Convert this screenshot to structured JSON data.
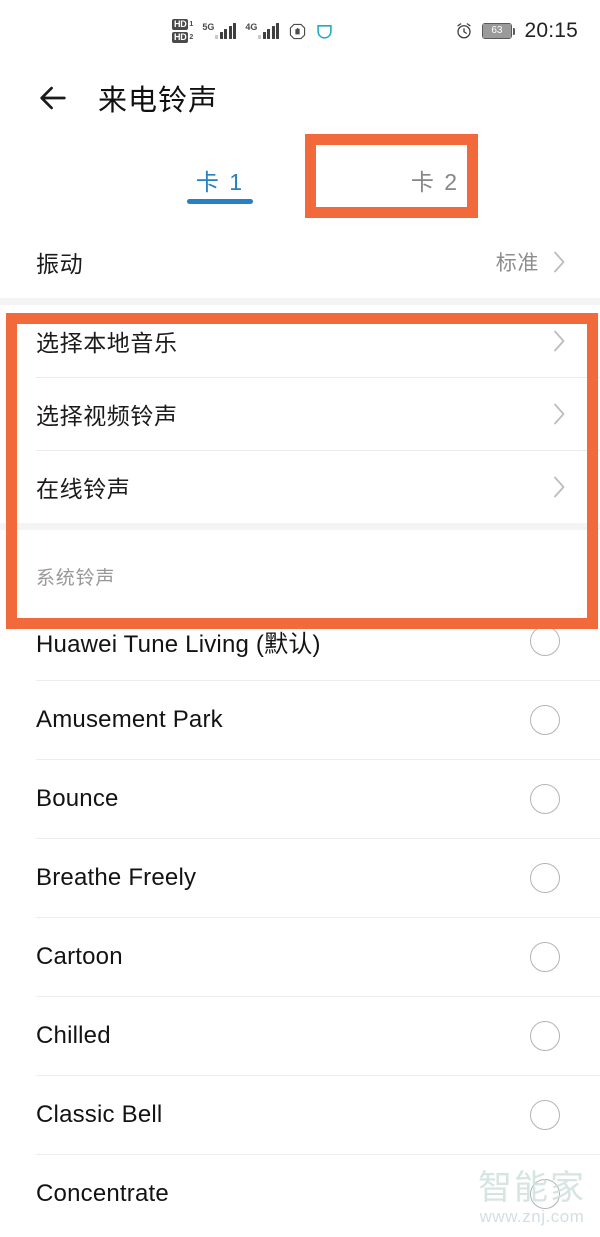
{
  "colors": {
    "annotation": "#f2693c",
    "accent_blue": "#2580c4",
    "divider": "#ebebeb",
    "band": "#f4f4f4",
    "muted_text": "#8d8d8d"
  },
  "status_bar": {
    "hd_primary": "HD",
    "hd_primary_sub": "1",
    "hd_secondary": "HD",
    "hd_secondary_sub": "2",
    "network_primary": "5G",
    "network_secondary": "4G",
    "hand_icon": "hand-stop-icon",
    "shield_icon": "shield-icon",
    "alarm_icon": "alarm-clock-icon",
    "battery_level": "63",
    "time": "20:15"
  },
  "appbar": {
    "back_icon": "back-arrow-icon",
    "title": "来电铃声"
  },
  "tabs": {
    "items": [
      {
        "label": "卡 1",
        "active": true
      },
      {
        "label": "卡 2",
        "active": false
      }
    ]
  },
  "vibration": {
    "title": "振动",
    "value": "标准",
    "chevron_icon": "chevron-right-icon"
  },
  "source_options": [
    {
      "title": "选择本地音乐",
      "chevron_icon": "chevron-right-icon"
    },
    {
      "title": "选择视频铃声",
      "chevron_icon": "chevron-right-icon"
    },
    {
      "title": "在线铃声",
      "chevron_icon": "chevron-right-icon"
    }
  ],
  "system_section": {
    "header": "系统铃声"
  },
  "ringtones": [
    {
      "name": "Huawei Tune Living (默认)",
      "selected": false
    },
    {
      "name": "Amusement Park",
      "selected": false
    },
    {
      "name": "Bounce",
      "selected": false
    },
    {
      "name": "Breathe Freely",
      "selected": false
    },
    {
      "name": "Cartoon",
      "selected": false
    },
    {
      "name": "Chilled",
      "selected": false
    },
    {
      "name": "Classic Bell",
      "selected": false
    },
    {
      "name": "Concentrate",
      "selected": false
    }
  ],
  "watermark": {
    "brand": "智能家",
    "url": "www.znj.com"
  }
}
